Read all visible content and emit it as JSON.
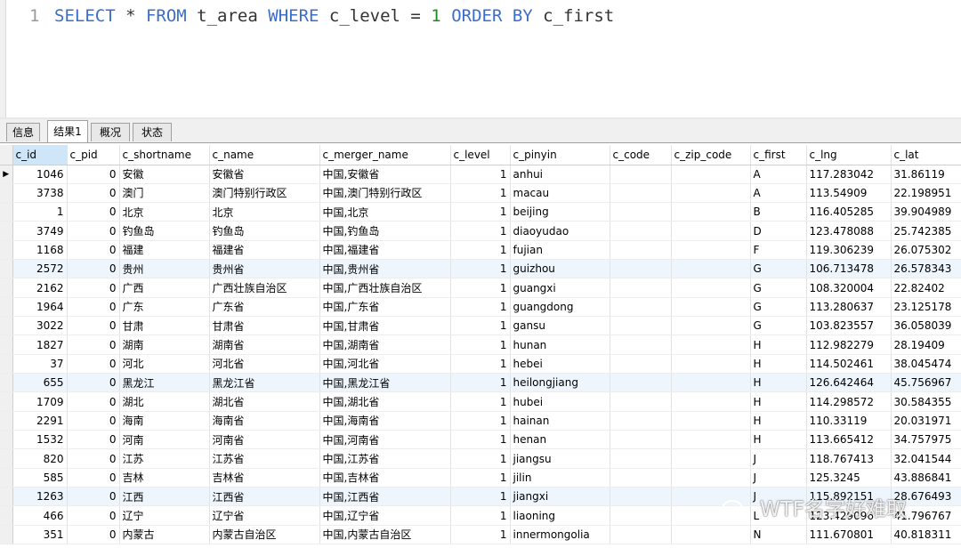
{
  "editor": {
    "line_number": "1",
    "tokens": {
      "select": "SELECT",
      "star": " * ",
      "from": "FROM",
      "table": " t_area ",
      "where": "WHERE",
      "cond": " c_level = ",
      "value": "1",
      "space": " ",
      "order_by": "ORDER BY",
      "col": " c_first"
    },
    "colors": {
      "keyword": "#3b6ec9",
      "number": "#1f8a1f",
      "text": "#333333"
    }
  },
  "tabs": [
    {
      "label": "信息"
    },
    {
      "label": "结果1"
    },
    {
      "label": "概况"
    },
    {
      "label": "状态"
    }
  ],
  "active_tab": "结果1",
  "columns": [
    "c_id",
    "c_pid",
    "c_shortname",
    "c_name",
    "c_merger_name",
    "c_level",
    "c_pinyin",
    "c_code",
    "c_zip_code",
    "c_first",
    "c_lng",
    "c_lat"
  ],
  "current_row_indicator": "▶",
  "rows": [
    [
      "1046",
      "0",
      "安徽",
      "安徽省",
      "中国,安徽省",
      "1",
      "anhui",
      "",
      "",
      "A",
      "117.283042",
      "31.86119"
    ],
    [
      "3738",
      "0",
      "澳门",
      "澳门特别行政区",
      "中国,澳门特别行政区",
      "1",
      "macau",
      "",
      "",
      "A",
      "113.54909",
      "22.198951"
    ],
    [
      "1",
      "0",
      "北京",
      "北京",
      "中国,北京",
      "1",
      "beijing",
      "",
      "",
      "B",
      "116.405285",
      "39.904989"
    ],
    [
      "3749",
      "0",
      "钓鱼岛",
      "钓鱼岛",
      "中国,钓鱼岛",
      "1",
      "diaoyudao",
      "",
      "",
      "D",
      "123.478088",
      "25.742385"
    ],
    [
      "1168",
      "0",
      "福建",
      "福建省",
      "中国,福建省",
      "1",
      "fujian",
      "",
      "",
      "F",
      "119.306239",
      "26.075302"
    ],
    [
      "2572",
      "0",
      "贵州",
      "贵州省",
      "中国,贵州省",
      "1",
      "guizhou",
      "",
      "",
      "G",
      "106.713478",
      "26.578343"
    ],
    [
      "2162",
      "0",
      "广西",
      "广西壮族自治区",
      "中国,广西壮族自治区",
      "1",
      "guangxi",
      "",
      "",
      "G",
      "108.320004",
      "22.82402"
    ],
    [
      "1964",
      "0",
      "广东",
      "广东省",
      "中国,广东省",
      "1",
      "guangdong",
      "",
      "",
      "G",
      "113.280637",
      "23.125178"
    ],
    [
      "3022",
      "0",
      "甘肃",
      "甘肃省",
      "中国,甘肃省",
      "1",
      "gansu",
      "",
      "",
      "G",
      "103.823557",
      "36.058039"
    ],
    [
      "1827",
      "0",
      "湖南",
      "湖南省",
      "中国,湖南省",
      "1",
      "hunan",
      "",
      "",
      "H",
      "112.982279",
      "28.19409"
    ],
    [
      "37",
      "0",
      "河北",
      "河北省",
      "中国,河北省",
      "1",
      "hebei",
      "",
      "",
      "H",
      "114.502461",
      "38.045474"
    ],
    [
      "655",
      "0",
      "黑龙江",
      "黑龙江省",
      "中国,黑龙江省",
      "1",
      "heilongjiang",
      "",
      "",
      "H",
      "126.642464",
      "45.756967"
    ],
    [
      "1709",
      "0",
      "湖北",
      "湖北省",
      "中国,湖北省",
      "1",
      "hubei",
      "",
      "",
      "H",
      "114.298572",
      "30.584355"
    ],
    [
      "2291",
      "0",
      "海南",
      "海南省",
      "中国,海南省",
      "1",
      "hainan",
      "",
      "",
      "H",
      "110.33119",
      "20.031971"
    ],
    [
      "1532",
      "0",
      "河南",
      "河南省",
      "中国,河南省",
      "1",
      "henan",
      "",
      "",
      "H",
      "113.665412",
      "34.757975"
    ],
    [
      "820",
      "0",
      "江苏",
      "江苏省",
      "中国,江苏省",
      "1",
      "jiangsu",
      "",
      "",
      "J",
      "118.767413",
      "32.041544"
    ],
    [
      "585",
      "0",
      "吉林",
      "吉林省",
      "中国,吉林省",
      "1",
      "jilin",
      "",
      "",
      "J",
      "125.3245",
      "43.886841"
    ],
    [
      "1263",
      "0",
      "江西",
      "江西省",
      "中国,江西省",
      "1",
      "jiangxi",
      "",
      "",
      "J",
      "115.892151",
      "28.676493"
    ],
    [
      "466",
      "0",
      "辽宁",
      "辽宁省",
      "中国,辽宁省",
      "1",
      "liaoning",
      "",
      "",
      "L",
      "123.429096",
      "41.796767"
    ],
    [
      "351",
      "0",
      "内蒙古",
      "内蒙古自治区",
      "中国,内蒙古自治区",
      "1",
      "innermongolia",
      "",
      "",
      "N",
      "111.670801",
      "40.818311"
    ]
  ],
  "watermark": {
    "text": "WTF名字好难取",
    "icon": "wechat-icon"
  }
}
